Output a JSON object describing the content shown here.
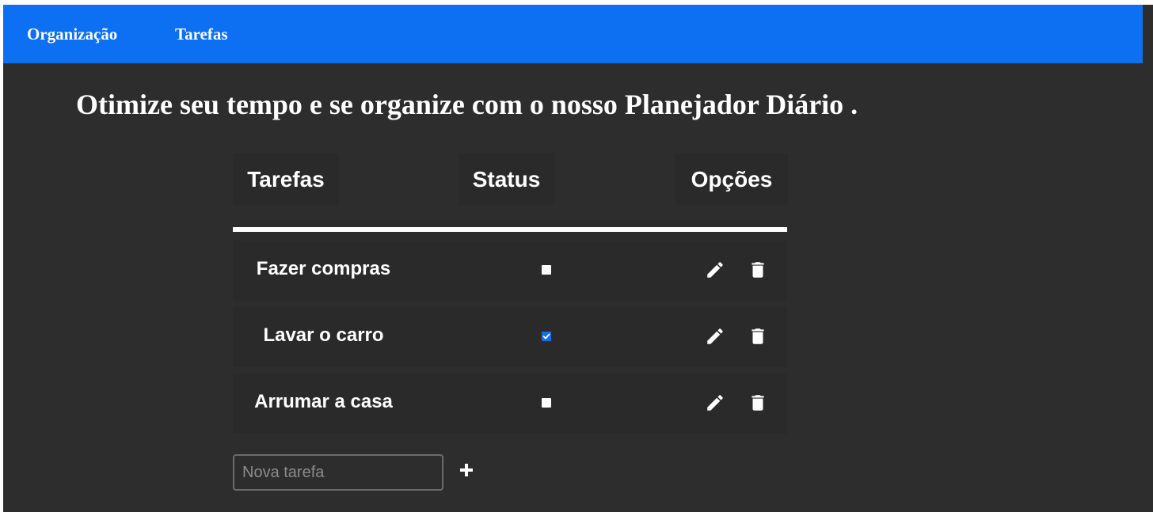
{
  "nav": {
    "items": [
      "Organização",
      "Tarefas"
    ]
  },
  "headline": "Otimize seu tempo e se organize com o nosso Planejador Diário .",
  "table": {
    "headers": [
      "Tarefas",
      "Status",
      "Opções"
    ],
    "rows": [
      {
        "task": "Fazer compras",
        "done": false
      },
      {
        "task": "Lavar o carro",
        "done": true
      },
      {
        "task": "Arrumar a casa",
        "done": false
      }
    ],
    "row_icons": [
      "pencil-icon",
      "trash-icon"
    ]
  },
  "add_task": {
    "placeholder": "Nova tarefa",
    "button_icon": "plus-icon"
  },
  "colors": {
    "navbar": "#0d6ff2",
    "background": "#2e2d2d",
    "row_background": "#2b2a2a",
    "text": "#ffffff",
    "checkbox_checked": "#0d6ff2"
  }
}
